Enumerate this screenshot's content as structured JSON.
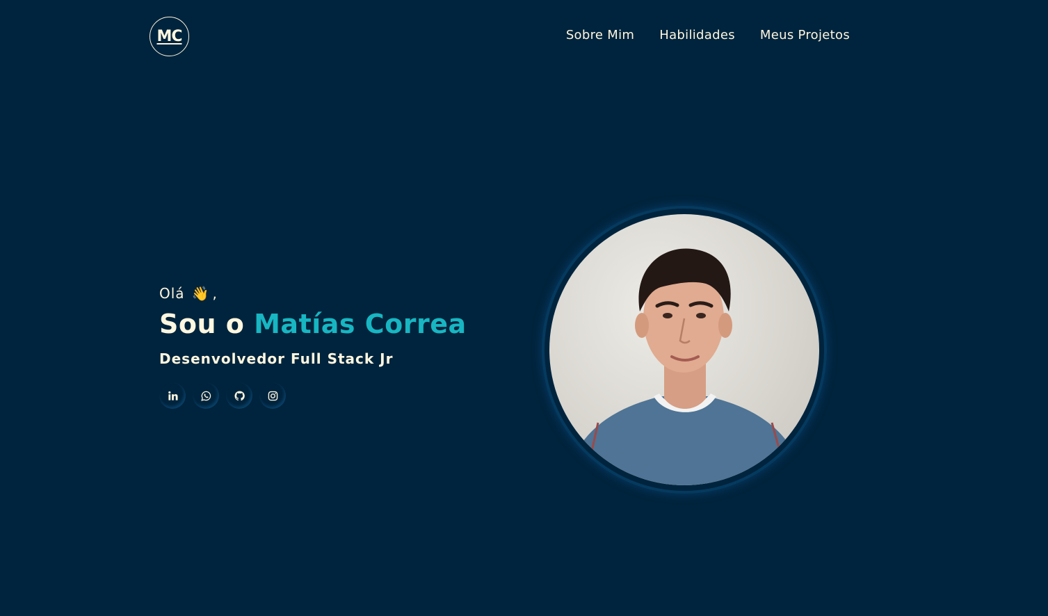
{
  "header": {
    "logo_text": "MC",
    "nav": [
      {
        "label": "Sobre Mim"
      },
      {
        "label": "Habilidades"
      },
      {
        "label": "Meus Projetos"
      }
    ]
  },
  "hero": {
    "greeting": "Olá",
    "greeting_suffix": ",",
    "wave_icon": "waving-hand-icon",
    "headline_prefix": "Sou o",
    "name": "Matías Correa",
    "subtitle": "Desenvolvedor Full Stack Jr",
    "socials": [
      {
        "icon": "linkedin-icon"
      },
      {
        "icon": "whatsapp-icon"
      },
      {
        "icon": "github-icon"
      },
      {
        "icon": "instagram-icon"
      }
    ],
    "portrait_alt": "profile-photo"
  },
  "colors": {
    "background": "#00243d",
    "text": "#fff7e0",
    "accent": "#17b6c2",
    "ring": "#053a5f"
  }
}
